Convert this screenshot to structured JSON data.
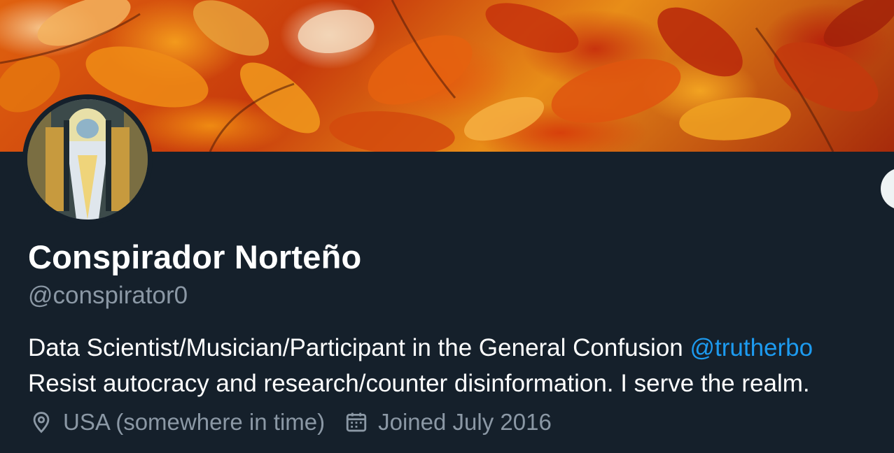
{
  "profile": {
    "display_name": "Conspirador Norteño",
    "handle": "@conspirator0",
    "bio": {
      "line1_text": "Data Scientist/Musician/Participant in the General Confusion ",
      "line1_mention": "@trutherbo",
      "line2_text": "Resist autocracy and research/counter disinformation. I serve the realm."
    },
    "location": "USA (somewhere in time)",
    "joined": "Joined July 2016"
  },
  "icons": {
    "location": "location-pin-icon",
    "joined": "calendar-icon"
  },
  "colors": {
    "background": "#15202b",
    "text_primary": "#ffffff",
    "text_secondary": "#8b98a5",
    "link": "#1d9bf0"
  }
}
